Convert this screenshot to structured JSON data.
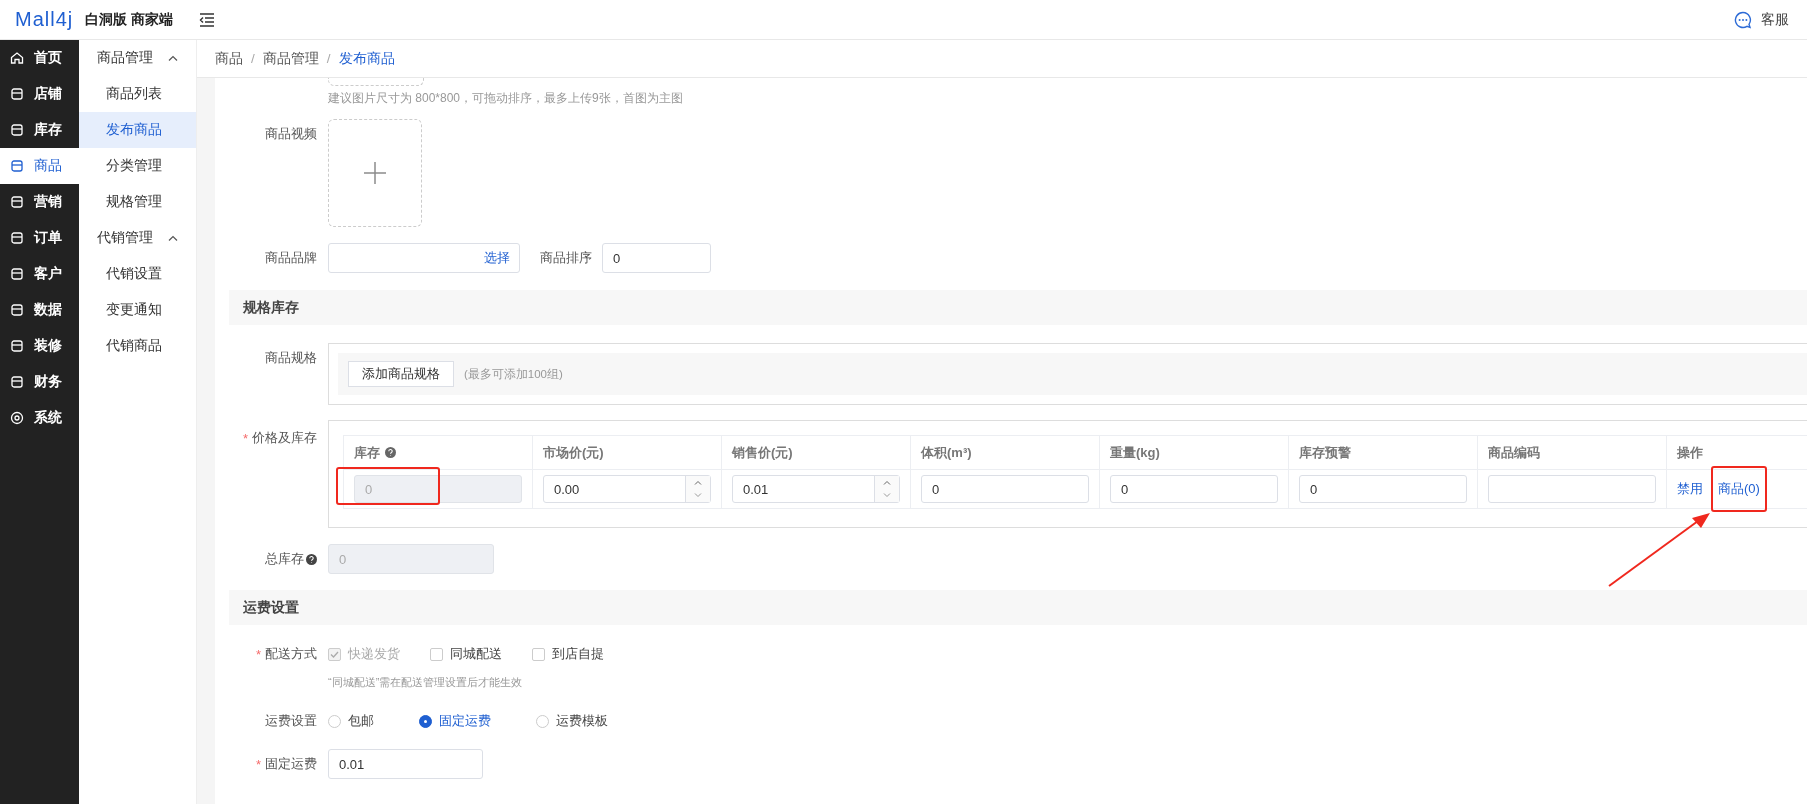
{
  "header": {
    "logo": "Mall4j",
    "edition": "白洞版 商家端",
    "service": "客服"
  },
  "main_nav": [
    {
      "label": "首页",
      "selected": false
    },
    {
      "label": "店铺",
      "selected": false
    },
    {
      "label": "库存",
      "selected": false
    },
    {
      "label": "商品",
      "selected": true
    },
    {
      "label": "营销",
      "selected": false
    },
    {
      "label": "订单",
      "selected": false
    },
    {
      "label": "客户",
      "selected": false
    },
    {
      "label": "数据",
      "selected": false
    },
    {
      "label": "装修",
      "selected": false
    },
    {
      "label": "财务",
      "selected": false
    },
    {
      "label": "系统",
      "selected": false
    }
  ],
  "sub_nav": [
    {
      "label": "商品管理",
      "expanded": true,
      "children": [
        {
          "label": "商品列表",
          "selected": false
        },
        {
          "label": "发布商品",
          "selected": true
        },
        {
          "label": "分类管理",
          "selected": false
        },
        {
          "label": "规格管理",
          "selected": false
        }
      ]
    },
    {
      "label": "代销管理",
      "expanded": true,
      "children": [
        {
          "label": "代销设置",
          "selected": false
        },
        {
          "label": "变更通知",
          "selected": false
        },
        {
          "label": "代销商品",
          "selected": false
        }
      ]
    }
  ],
  "breadcrumb": {
    "separator": "/",
    "items": [
      "商品",
      "商品管理",
      "发布商品"
    ]
  },
  "required_mark": "*",
  "form": {
    "image_hint": "建议图片尺寸为 800*800，可拖动排序，最多上传9张，首图为主图",
    "video_label": "商品视频",
    "brand": {
      "label": "商品品牌",
      "action": "选择"
    },
    "sort": {
      "label": "商品排序",
      "value": "0"
    },
    "spec_section": "规格库存",
    "spec": {
      "label": "商品规格",
      "button": "添加商品规格",
      "hint": "(最多可添加100组)"
    },
    "price_stock": {
      "label": "价格及库存",
      "required": true,
      "columns": [
        {
          "label": "库存",
          "help": true
        },
        {
          "label": "市场价(元)"
        },
        {
          "label": "销售价(元)"
        },
        {
          "label": "体积(m³)"
        },
        {
          "label": "重量(kg)"
        },
        {
          "label": "库存预警"
        },
        {
          "label": "商品编码"
        },
        {
          "label": "操作"
        }
      ],
      "rows": [
        {
          "cells": [
            {
              "kind": "input",
              "value": "0",
              "disabled": true,
              "highlighted": true
            },
            {
              "kind": "number",
              "value": "0.00"
            },
            {
              "kind": "number",
              "value": "0.01"
            },
            {
              "kind": "input",
              "value": "0",
              "disabled": false,
              "highlighted": false
            },
            {
              "kind": "input",
              "value": "0",
              "disabled": false,
              "highlighted": false
            },
            {
              "kind": "input",
              "value": "0",
              "disabled": false,
              "highlighted": false
            },
            {
              "kind": "input",
              "disabled": false,
              "highlighted": false
            },
            {
              "kind": "actions",
              "links": [
                {
                  "label": "禁用",
                  "highlighted": false
                },
                {
                  "label": "商品(0)",
                  "highlighted": true
                }
              ]
            }
          ]
        }
      ]
    },
    "total_stock": {
      "label": "总库存",
      "value": "0",
      "disabled": true
    },
    "shipping_section": "运费设置",
    "delivery": {
      "label": "配送方式",
      "required": true,
      "options": [
        {
          "label": "快递发货",
          "checked": true,
          "disabled": true
        },
        {
          "label": "同城配送",
          "checked": false,
          "disabled": false
        },
        {
          "label": "到店自提",
          "checked": false,
          "disabled": false
        }
      ],
      "note": "“同城配送”需在配送管理设置后才能生效"
    },
    "fee_mode": {
      "label": "运费设置",
      "options": [
        {
          "label": "包邮",
          "selected": false
        },
        {
          "label": "固定运费",
          "selected": true
        },
        {
          "label": "运费模板",
          "selected": false
        }
      ]
    },
    "fixed_fee": {
      "label": "固定运费",
      "required": true,
      "value": "0.01"
    }
  }
}
